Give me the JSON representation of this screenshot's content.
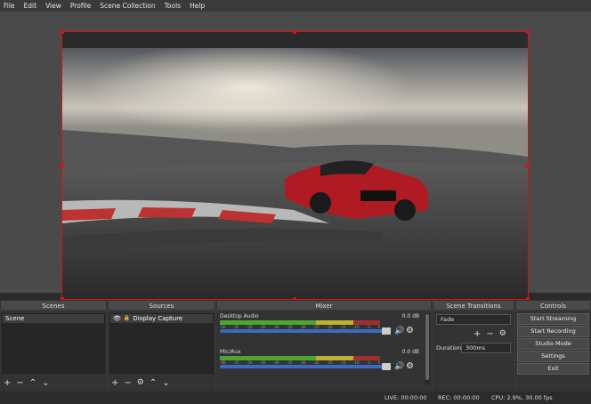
{
  "menu": [
    "File",
    "Edit",
    "View",
    "Profile",
    "Scene Collection",
    "Tools",
    "Help"
  ],
  "scenes": {
    "title": "Scenes",
    "items": [
      "Scene"
    ]
  },
  "sources": {
    "title": "Sources",
    "items": [
      "Display Capture"
    ]
  },
  "mixer": {
    "title": "Mixer",
    "tracks": [
      {
        "name": "Desktop Audio",
        "db": "0.0 dB",
        "level": 0.87
      },
      {
        "name": "Mic/Aux",
        "db": "0.0 dB",
        "level": 0.87
      }
    ],
    "ticks": [
      "-60",
      "-55",
      "-50",
      "-45",
      "-40",
      "-35",
      "-30",
      "-25",
      "-20",
      "-15",
      "-10",
      "-5",
      "0"
    ]
  },
  "transitions": {
    "title": "Scene Transitions",
    "selected": "Fade",
    "duration_label": "Duration",
    "duration_value": "300ms"
  },
  "controls": {
    "title": "Controls",
    "buttons": [
      "Start Streaming",
      "Start Recording",
      "Studio Mode",
      "Settings",
      "Exit"
    ]
  },
  "status": {
    "live": "LIVE: 00:00:00",
    "rec": "REC: 00:00:00",
    "cpu": "CPU: 2.9%, 30.00 fps"
  },
  "icons": {
    "eye": "eye-icon",
    "lock": "lock-icon",
    "gear": "gear-icon",
    "volume": "volume-icon"
  }
}
